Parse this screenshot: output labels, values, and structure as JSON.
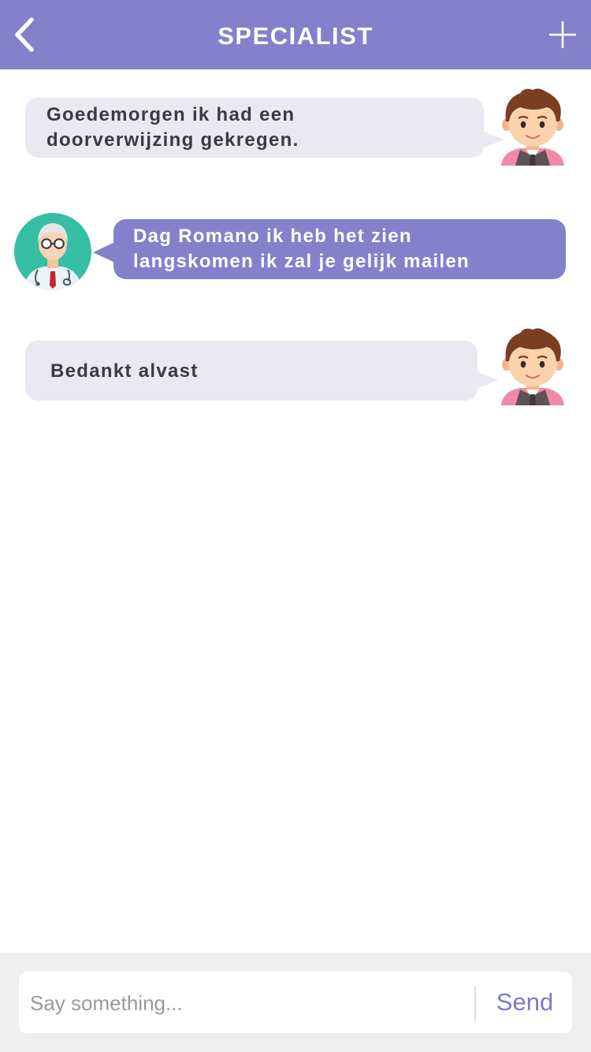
{
  "header": {
    "title": "SPECIALIST",
    "back_icon": "chevron-left-icon",
    "add_icon": "plus-icon"
  },
  "messages": [
    {
      "side": "sent",
      "lines": [
        "Goedemorgen ik had een",
        "doorverwijzing gekregen."
      ]
    },
    {
      "side": "received",
      "lines": [
        "Dag Romano ik heb het zien",
        "langskomen ik zal je gelijk mailen"
      ]
    },
    {
      "side": "sent",
      "lines": [
        "Bedankt alvast"
      ]
    }
  ],
  "composer": {
    "placeholder": "Say something...",
    "value": "",
    "send_label": "Send"
  },
  "colors": {
    "accent": "#8480cc",
    "sent_bubble": "#eae9f1",
    "footer_bg": "#efefef",
    "send_text": "#7d78c8"
  }
}
